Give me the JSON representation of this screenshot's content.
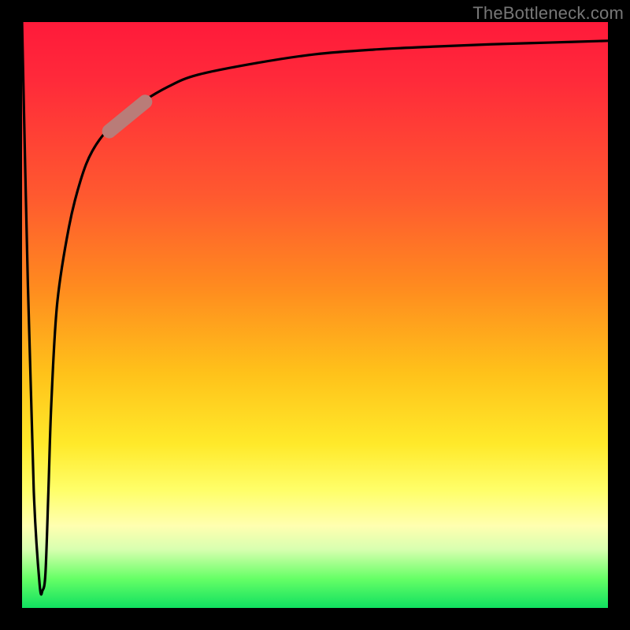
{
  "watermark": "TheBottleneck.com",
  "colors": {
    "background": "#000000",
    "gradient_top": "#ff1a3a",
    "gradient_bottom": "#10e060",
    "curve": "#000000",
    "mark": "#b97c78",
    "watermark_text": "#777777"
  },
  "chart_data": {
    "type": "line",
    "title": "",
    "xlabel": "",
    "ylabel": "",
    "xlim": [
      0,
      100
    ],
    "ylim": [
      0,
      100
    ],
    "grid": false,
    "legend": false,
    "annotations": [
      {
        "kind": "segment-highlight",
        "x_range": [
          14,
          22
        ],
        "note": "thick pale mark on curve"
      }
    ],
    "series": [
      {
        "name": "curve",
        "x": [
          0,
          1,
          2,
          3,
          3.5,
          4,
          4.5,
          5,
          6,
          8,
          10,
          12,
          15,
          20,
          25,
          30,
          40,
          50,
          60,
          70,
          80,
          90,
          100
        ],
        "y": [
          100,
          55,
          20,
          4,
          3,
          6,
          20,
          35,
          52,
          65,
          73,
          78,
          82,
          86,
          89,
          91,
          93,
          94.5,
          95.3,
          95.8,
          96.2,
          96.5,
          96.8
        ]
      }
    ]
  }
}
